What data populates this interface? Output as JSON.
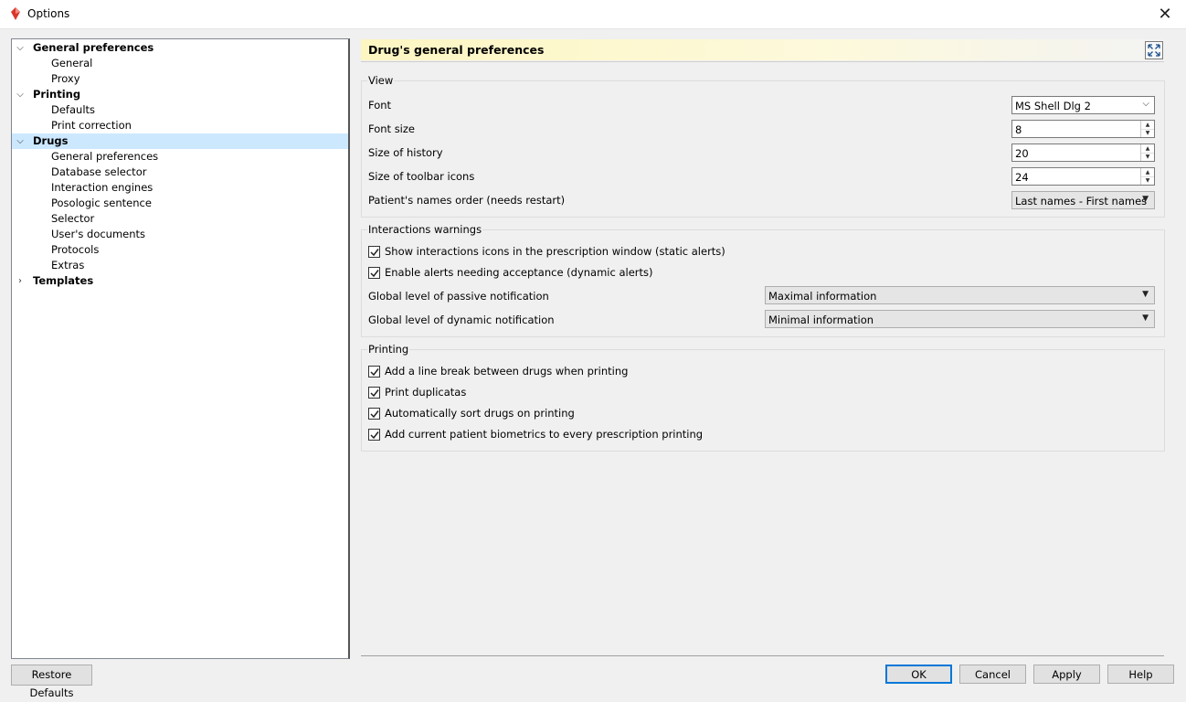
{
  "window": {
    "title": "Options",
    "close_glyph": "✕"
  },
  "tree": [
    {
      "label": "General preferences",
      "level": 0,
      "expanded": true
    },
    {
      "label": "General",
      "level": 1
    },
    {
      "label": "Proxy",
      "level": 1
    },
    {
      "label": "Printing",
      "level": 0,
      "expanded": true
    },
    {
      "label": "Defaults",
      "level": 1
    },
    {
      "label": "Print correction",
      "level": 1
    },
    {
      "label": "Drugs",
      "level": 0,
      "expanded": true,
      "selected": true
    },
    {
      "label": "General preferences",
      "level": 1
    },
    {
      "label": "Database selector",
      "level": 1
    },
    {
      "label": "Interaction engines",
      "level": 1
    },
    {
      "label": "Posologic sentence",
      "level": 1
    },
    {
      "label": "Selector",
      "level": 1
    },
    {
      "label": "User's documents",
      "level": 1
    },
    {
      "label": "Protocols",
      "level": 1
    },
    {
      "label": "Extras",
      "level": 1
    },
    {
      "label": "Templates",
      "level": 0,
      "expanded": false
    }
  ],
  "restore_defaults": "Restore Defaults",
  "header": {
    "title": "Drug's general preferences"
  },
  "view": {
    "title": "View",
    "font_label": "Font",
    "font_value": "MS Shell Dlg 2",
    "font_size_label": "Font size",
    "font_size_value": "8",
    "history_label": "Size of history",
    "history_value": "20",
    "toolbar_label": "Size of toolbar icons",
    "toolbar_value": "24",
    "names_order_label": "Patient's names order (needs restart)",
    "names_order_value": "Last names - First names"
  },
  "interactions": {
    "title": "Interactions warnings",
    "show_icons": "Show interactions icons in the prescription window (static alerts)",
    "enable_alerts": "Enable alerts needing acceptance (dynamic alerts)",
    "passive_label": "Global level of passive notification",
    "passive_value": "Maximal information",
    "dynamic_label": "Global level of dynamic notification",
    "dynamic_value": "Minimal information"
  },
  "printing": {
    "title": "Printing",
    "line_break": "Add a line break between drugs when printing",
    "duplicatas": "Print duplicatas",
    "auto_sort": "Automatically sort drugs on printing",
    "biometrics": "Add current patient biometrics to every prescription printing"
  },
  "buttons": {
    "ok": "OK",
    "cancel": "Cancel",
    "apply": "Apply",
    "help": "Help"
  },
  "colors": {
    "selection": "#cce8ff",
    "accent": "#0078d7",
    "header_bg": "#fdf6c2"
  }
}
